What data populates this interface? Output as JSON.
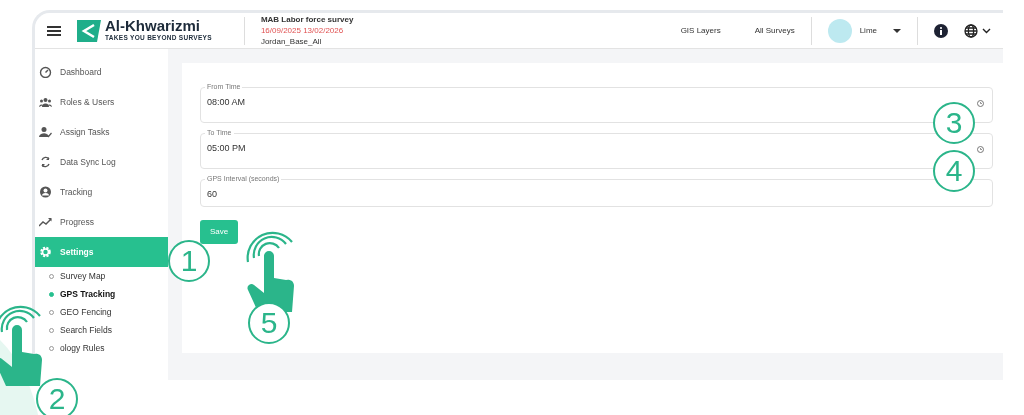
{
  "header": {
    "app_name": "Al-Khwarizmi",
    "tagline": "TAKES YOU BEYOND SURVEYS",
    "survey_title": "MAB Labor force survey",
    "date_range": "16/09/2025 13/02/2026",
    "base": "Jordan_Base_All",
    "nav_links": [
      "GIS Layers",
      "All Surveys"
    ],
    "user": "Lime"
  },
  "sidebar": {
    "items": [
      {
        "label": "Dashboard",
        "selected": false
      },
      {
        "label": "Roles & Users",
        "selected": false
      },
      {
        "label": "Assign Tasks",
        "selected": false
      },
      {
        "label": "Data Sync Log",
        "selected": false
      },
      {
        "label": "Tracking",
        "selected": false
      },
      {
        "label": "Progress",
        "selected": false
      },
      {
        "label": "Settings",
        "selected": true,
        "expanded": true,
        "children": [
          {
            "label": "Survey Map",
            "selected": false
          },
          {
            "label": "GPS Tracking",
            "selected": true
          },
          {
            "label": "GEO Fencing",
            "selected": false
          },
          {
            "label": "Search Fields",
            "selected": false
          },
          {
            "label": "ology Rules",
            "selected": false
          }
        ]
      }
    ]
  },
  "form": {
    "fields": [
      {
        "kind": "time",
        "label": "From Time",
        "value": "08:00 AM"
      },
      {
        "kind": "time",
        "label": "To Time",
        "value": "05:00 PM"
      },
      {
        "kind": "number",
        "label": "GPS Interval (seconds)",
        "value": "60"
      }
    ],
    "save_button": "Save"
  },
  "callouts": [
    "1",
    "2",
    "3",
    "4",
    "5"
  ]
}
